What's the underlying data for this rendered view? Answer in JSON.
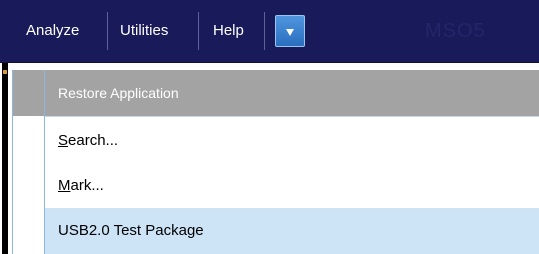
{
  "menubar": {
    "items": [
      {
        "label": "Analyze"
      },
      {
        "label": "Utilities"
      },
      {
        "label": "Help"
      }
    ],
    "dropdown_icon": "triangle-down-icon",
    "watermark": "MSO5"
  },
  "dropdown_menu": {
    "header": "Restore Application",
    "items": [
      {
        "mnemonic": "S",
        "rest": "earch..."
      },
      {
        "mnemonic": "M",
        "rest": "ark..."
      },
      {
        "label": "USB2.0 Test Package"
      }
    ]
  },
  "colors": {
    "menubar_bg": "#191a59",
    "dropdown_button": "#3a82d2",
    "header_highlight": "#a3a3a3",
    "selected_row": "#cde4f7"
  }
}
